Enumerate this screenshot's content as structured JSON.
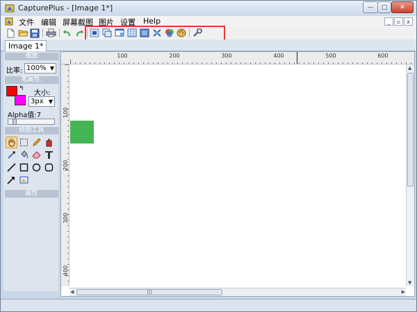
{
  "window": {
    "title": "CapturePlus - [Image 1*]",
    "controls": {
      "minimize": "—",
      "maximize": "□",
      "close": "✕"
    }
  },
  "menu": {
    "items": [
      "文件",
      "编辑",
      "屏幕截图",
      "图片",
      "设置",
      "Help"
    ],
    "mdi": {
      "minimize": "_",
      "restore": "▫",
      "close": "x"
    }
  },
  "toolbar": {
    "file_buttons": [
      "new-file-icon",
      "open-folder-icon",
      "save-icon",
      "print-icon",
      "undo-icon",
      "redo-icon"
    ],
    "capture_buttons": [
      "capture-fullscreen-icon",
      "capture-window-icon",
      "capture-region-icon",
      "capture-scroll-icon",
      "capture-object-icon",
      "capture-freehand-icon",
      "capture-color-icon",
      "capture-palette-icon",
      "tools-icon"
    ]
  },
  "tabs": [
    {
      "label": "Image 1*"
    }
  ],
  "left_panel": {
    "zoom": {
      "header": "缩放",
      "label": "比率:",
      "value": "100%"
    },
    "pen": {
      "header": "笔属性:",
      "size_label": "大小:",
      "size_value": "3px",
      "alpha_label": "Alpha值:7",
      "alpha_level": 0.1,
      "primary_color": "#ff0000",
      "secondary_color": "#ff00ff"
    },
    "tools_header": "绘图工具",
    "tools": [
      "hand-icon",
      "select-rect-icon",
      "pencil-icon",
      "bottle-icon",
      "eyedropper-icon",
      "fill-bucket-icon",
      "eraser-icon",
      "text-tool-icon",
      "line-icon",
      "rectangle-icon",
      "ellipse-icon",
      "rounded-rect-icon",
      "arrow-icon",
      "stamp-icon"
    ],
    "properties_header": "属性"
  },
  "canvas": {
    "ruler_h_labels": [
      "100",
      "200",
      "300",
      "400",
      "500",
      "600"
    ],
    "ruler_v_labels": [
      "100",
      "200",
      "300",
      "400"
    ],
    "shape_color": "#45b554",
    "hscroll_grip": "|||"
  },
  "colors": {
    "highlight": "#e53935"
  }
}
